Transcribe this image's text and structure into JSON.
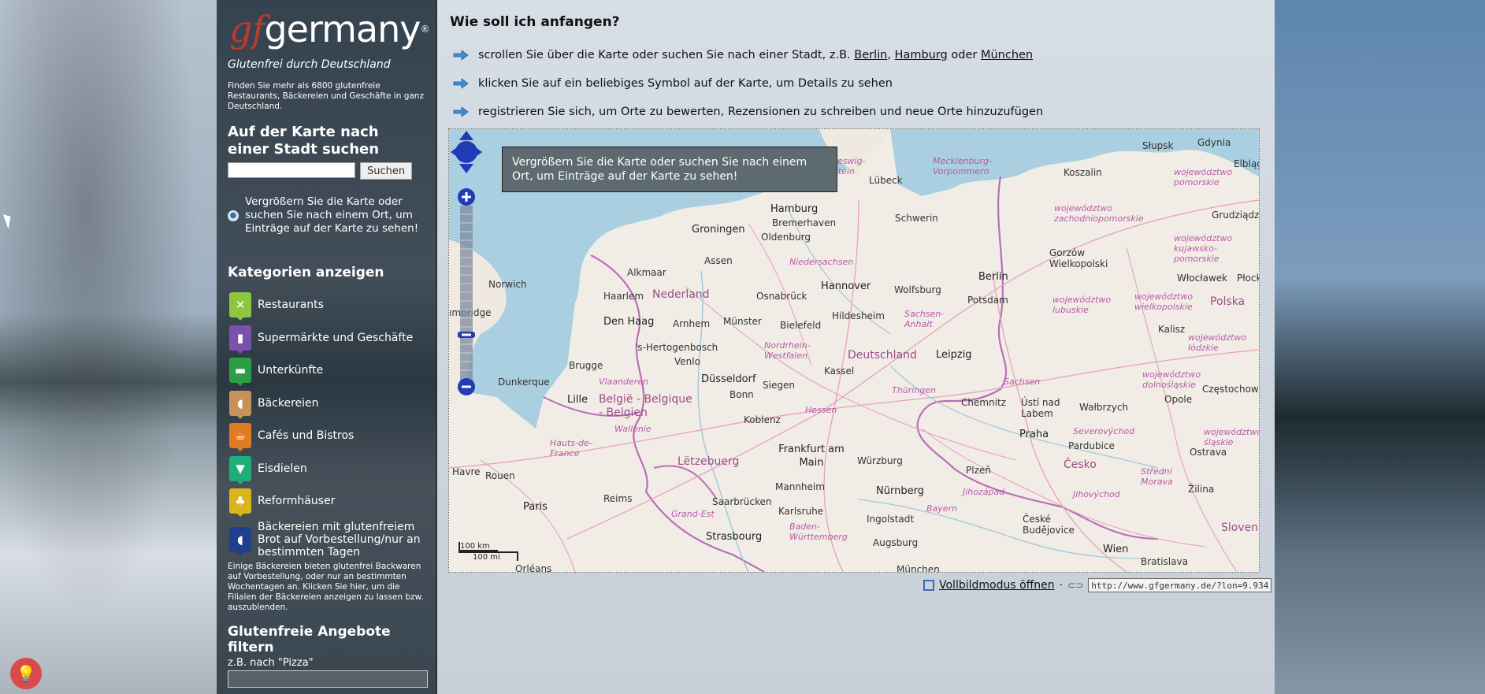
{
  "sidebar": {
    "logo_gf": "gf",
    "logo_de": "germany",
    "logo_reg": "®",
    "tagline": "Glutenfrei durch Deutschland",
    "intro": "Finden Sie mehr als 6800 glutenfreie Restaurants, Bäckereien und Geschäfte in ganz Deutschland.",
    "search_heading": "Auf der Karte nach einer Stadt suchen",
    "search_placeholder": "",
    "search_button": "Suchen",
    "zoom_note": "Vergrößern Sie die Karte oder suchen Sie nach einem Ort, um Einträge auf der Karte zu sehen!",
    "categories_heading": "Kategorien anzeigen",
    "categories": [
      {
        "label": "Restaurants",
        "color": "#8dc63f",
        "icon": "cutlery-icon",
        "glyph": "✕"
      },
      {
        "label": "Supermärkte und Geschäfte",
        "color": "#7b52ab",
        "icon": "shop-icon",
        "glyph": "▮"
      },
      {
        "label": "Unterkünfte",
        "color": "#2e9e46",
        "icon": "bed-icon",
        "glyph": "▬"
      },
      {
        "label": "Bäckereien",
        "color": "#c8915a",
        "icon": "bread-icon",
        "glyph": "◖"
      },
      {
        "label": "Cafés und Bistros",
        "color": "#e07b22",
        "icon": "coffee-icon",
        "glyph": "☕"
      },
      {
        "label": "Eisdielen",
        "color": "#1fae7a",
        "icon": "icecream-icon",
        "glyph": "▼"
      },
      {
        "label": "Reformhäuser",
        "color": "#d8b61a",
        "icon": "wheat-icon",
        "glyph": "♣"
      },
      {
        "label": "Bäckereien mit glutenfreiem Brot auf Vorbestellung/nur an bestimmten Tagen",
        "color": "#1e3f8c",
        "icon": "bakery-order-icon",
        "glyph": "◖"
      }
    ],
    "category_note": "Einige Bäckereien bieten glutenfrei Backwaren auf Vorbestellung, oder nur an bestimmten Wochentagen an. Klicken Sie hier, um die Filialen der Bäckereien anzeigen zu lassen bzw. auszublenden.",
    "filter_heading": "Glutenfreie Angebote filtern",
    "filter_hint": "z.B. nach \"Pizza\"",
    "filter_value": ""
  },
  "main": {
    "title": "Wie soll ich anfangen?",
    "step1_prefix": "scrollen Sie über die Karte oder suchen Sie nach einer Stadt, z.B.",
    "step1_link1": "Berlin",
    "step1_sep1": ",",
    "step1_link2": "Hamburg",
    "step1_sep2": "oder",
    "step1_link3": "München",
    "step2": "klicken Sie auf ein beliebiges Symbol auf der Karte, um Details zu sehen",
    "step3": "registrieren Sie sich, um Orte zu bewerten, Rezensionen zu schreiben und neue Orte hinzuzufügen",
    "map_message": "Vergrößern Sie die Karte oder suchen Sie nach einem Ort, um Einträge auf der Karte zu sehen!",
    "scale_km": "100 km",
    "scale_mi": "100 mi",
    "fullscreen_label": "Vollbildmodus öffnen",
    "separator": "·",
    "url_value": "http://www.gfgermany.de/?lon=9.9344"
  },
  "map_labels": {
    "slupsk": "Słupsk",
    "gdynia": "Gdynia",
    "elblag": "Elbląg",
    "koszalin": "Koszalin",
    "pomorskie": "województwo pomorskie",
    "schleswig": "Schleswig-Holstein",
    "lubeck": "Lübeck",
    "mecklenburg": "Mecklenburg-Vorpommern",
    "zachodnio": "województwo zachodniopomorskie",
    "grudziadz": "Grudziądz",
    "hamburg": "Hamburg",
    "schwerin": "Schwerin",
    "bremerhaven": "Bremerhaven",
    "groningen": "Groningen",
    "oldenburg": "Oldenburg",
    "assen": "Assen",
    "niedersachsen": "Niedersachsen",
    "gorzow": "Gorzów Wielkopolski",
    "kujawsko": "województwo kujawsko-pomorskie",
    "alkmaar": "Alkmaar",
    "hannover": "Hannover",
    "berlin": "Berlin",
    "norwich": "Norwich",
    "wolfsburg": "Wolfsburg",
    "lubuskie": "województwo lubuskie",
    "wielkopolskie": "województwo wielkopolskie",
    "wloclawek": "Włocławek",
    "plock": "Płock",
    "haarlem": "Haarlem",
    "nederland": "Nederland",
    "osnabruck": "Osnabrück",
    "potsdam": "Potsdam",
    "polska": "Polska",
    "cambridge": "ımbridge",
    "denhaag": "Den Haag",
    "arnhem": "Arnhem",
    "munster": "Münster",
    "bielefeld": "Bielefeld",
    "hildesheim": "Hildesheim",
    "sachsenanhalt": "Sachsen-Anhalt",
    "kalisz": "Kalisz",
    "hertogenbosch": "'s-Hertogenbosch",
    "nordrhein": "Nordrhein-Westfalen",
    "lodzkie": "województwo łódzkie",
    "venlo": "Venlo",
    "deutschland": "Deutschland",
    "leipzig": "Leipzig",
    "brugge": "Brugge",
    "kassel": "Kassel",
    "dunkerque": "Dunkerque",
    "vlaanderen": "Vlaanderen",
    "dusseldorf": "Düsseldorf",
    "siegen": "Siegen",
    "sachsen": "Sachsen",
    "dolnoslaskie": "województwo dolnośląskie",
    "thuringen": "Thüringen",
    "bonn": "Bonn",
    "lille": "Lille",
    "belgie": "België - Belgique - Belgien",
    "czestochowa": "Częstochowa",
    "chemnitz": "Chemnitz",
    "usti": "Ústí nad Labem",
    "walbrzych": "Wałbrzych",
    "opole": "Opole",
    "hessen": "Hessen",
    "koblenz": "Koblenz",
    "wallonie": "Wallonie",
    "severo": "Severovýchod",
    "praha": "Praha",
    "pardubice": "Pardubice",
    "hautsdefrance": "Hauts-de-France",
    "frankfurt": "Frankfurt am Main",
    "wurzburg": "Würzburg",
    "slaskie": "województwo śląskie",
    "letzebuerg": "Lëtzebuerg",
    "ostrava": "Ostrava",
    "cesko": "Česko",
    "havre": "Havre",
    "rouen": "Rouen",
    "mannheim": "Mannheim",
    "nurnberg": "Nürnberg",
    "plzen": "Plzeň",
    "strednimorava": "Střední Morava",
    "reims": "Reims",
    "zilina": "Žilina",
    "jihozapad": "Jihozápad",
    "jihovychod": "Jihovýchod",
    "saarbrucken": "Saarbrücken",
    "karlsruhe": "Karlsruhe",
    "ingolstadt": "Ingolstadt",
    "bayern": "Bayern",
    "paris": "Paris",
    "grandest": "Grand-Est",
    "badenwurttemberg": "Baden-Württemberg",
    "ceske": "České Budějovice",
    "slovensko": "Slovens",
    "strasbourg": "Strasbourg",
    "augsburg": "Augsburg",
    "wien": "Wien",
    "bratislava": "Bratislava",
    "orleans": "Orléans",
    "munchen": "München"
  }
}
